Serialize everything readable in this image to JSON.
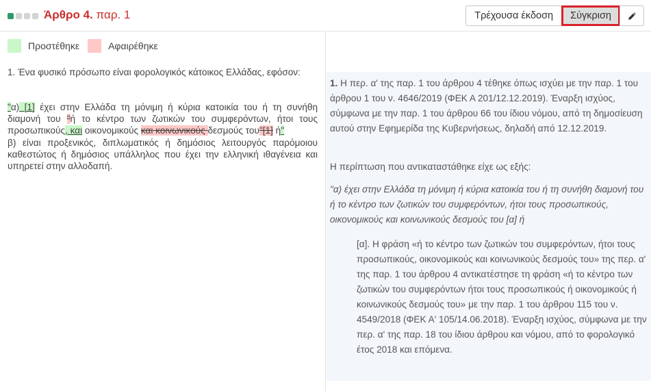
{
  "header": {
    "title_bold": "Άρθρο 4.",
    "title_rest": " παρ. 1",
    "buttons": {
      "current_version": "Τρέχουσα έκδοση",
      "compare": "Σύγκριση",
      "edit_icon": "pencil-icon"
    }
  },
  "legend": {
    "added": "Προστέθηκε",
    "removed": "Αφαιρέθηκε"
  },
  "left": {
    "p1": "1. Ένα φυσικό πρόσωπο είναι φορολογικός κάτοικος Ελλάδας, εφόσον:",
    "p2": [
      {
        "t": "\"",
        "c": "ins"
      },
      {
        "t": "α)",
        "c": ""
      },
      {
        "t": " [1]",
        "c": "ins"
      },
      {
        "t": " έχει στην Ελλάδα τη μόνιμη ή κύρια κατοικία του ή τη συνήθη διαμονή του ",
        "c": ""
      },
      {
        "t": "\"",
        "c": "del"
      },
      {
        "t": "ή το κέντρο των ζωτικών του συμφερόντων, ήτοι τους προσωπικούς",
        "c": ""
      },
      {
        "t": ", και",
        "c": "ins"
      },
      {
        "t": " οικονομικούς ",
        "c": ""
      },
      {
        "t": "και κοινωνικούς ",
        "c": "del"
      },
      {
        "t": "δεσμούς του",
        "c": ""
      },
      {
        "t": "\"[1]",
        "c": "del"
      },
      {
        "t": " ή",
        "c": ""
      },
      {
        "t": "\"",
        "c": "ins"
      }
    ],
    "p3": "β) είναι προξενικός, διπλωματικός ή δημόσιος λειτουργός παρόμοιου καθεστώτος ή δημόσιος υπάλληλος που έχει την ελληνική ιθαγένεια και υπηρετεί στην αλλοδαπή."
  },
  "right": {
    "r1_num": "1.",
    "r1_text": " Η περ. α' της παρ. 1 του άρθρου 4 τέθηκε όπως ισχύει με την παρ. 1 του άρθρου 1 του ν. 4646/2019 (ΦΕΚ Α 201/12.12.2019). Έναρξη ισχύος, σύμφωνα με την παρ. 1 του άρθρου 66 του ίδιου νόμου, από τη δημοσίευση αυτού στην Εφημερίδα της Κυβερνήσεως, δηλαδή από 12.12.2019.",
    "r2": "Η περίπτωση που αντικαταστάθηκε είχε ως εξής:",
    "r3": "\"α) έχει στην Ελλάδα τη μόνιμη ή κύρια κατοικία του ή τη συνήθη διαμονή του ή το κέντρο των ζωτικών του συμφερόντων, ήτοι τους προσωπικούς, οικονομικούς και κοινωνικούς δεσμούς του [α] ή",
    "r4": "[α]. Η φράση «ή το κέντρο των ζωτικών του συμφερόντων, ήτοι τους προσωπικούς, οικονομικούς και κοινωνικούς δεσμούς του» της περ. α' της παρ. 1 του άρθρου 4 αντικατέστησε τη φράση «ή το κέντρο των ζωτικών του συμφερόντων ήτοι τους προσωπικούς ή οικονομικούς ή κοινωνικούς δεσμούς του» με την παρ. 1 του άρθρου 115 του ν. 4549/2018 (ΦΕΚ Α' 105/14.06.2018). Έναρξη ισχύος, σύμφωνα με την περ. α' της παρ. 18 του ίδιου άρθρου και νόμου, από το φορολογικό έτος 2018 και επόμενα."
  },
  "colors": {
    "title": "#c9302c",
    "added": "#c9f7c9",
    "removed": "#ffc8c8",
    "highlight_border": "#d9202a",
    "step_active": "#2e9a6a"
  }
}
